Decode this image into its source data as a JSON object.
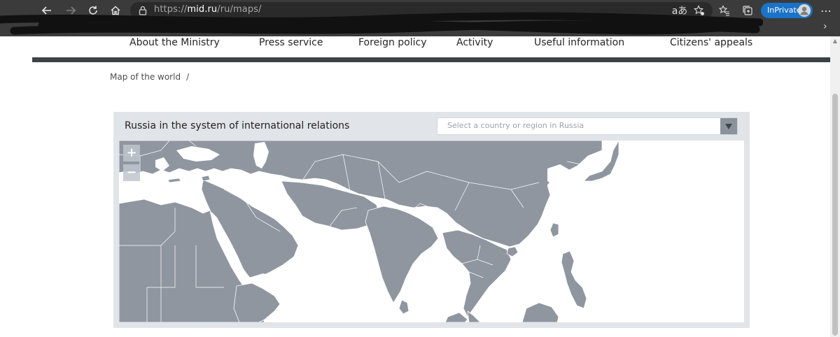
{
  "browser": {
    "url_prefix": "https://",
    "url_host": "mid.ru",
    "url_path": "/ru/maps/",
    "translate_icon": "aあ",
    "inprivate_label": "InPrivate"
  },
  "menu": {
    "items": [
      {
        "label": "About the Ministry"
      },
      {
        "label": "Press service"
      },
      {
        "label": "Foreign policy"
      },
      {
        "label": "Activity"
      },
      {
        "label": "Useful information"
      },
      {
        "label": "Citizens' appeals"
      }
    ]
  },
  "breadcrumb": {
    "current": "Map of the world",
    "separator": "/"
  },
  "map": {
    "title": "Russia in the system of international relations",
    "select_placeholder": "Select a country or region in Russia",
    "zoom_in_label": "+",
    "zoom_out_label": "−",
    "land_color": "#8f969f",
    "border_color": "#ffffff"
  }
}
